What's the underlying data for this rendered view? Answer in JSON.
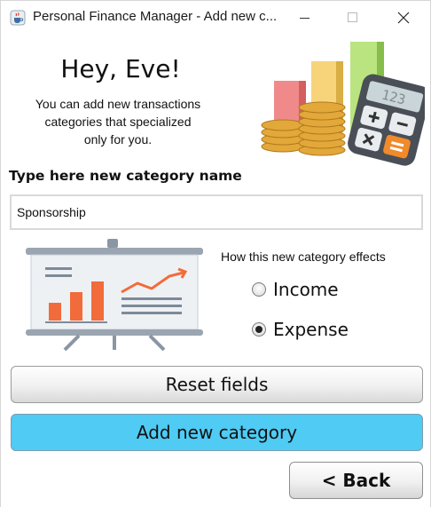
{
  "window": {
    "title": "Personal Finance Manager - Add new c...",
    "app_icon": "java-coffee-cup-icon",
    "controls": [
      "minimize-icon",
      "maximize-icon",
      "close-icon"
    ]
  },
  "header": {
    "greeting": "Hey, Eve!",
    "subtitle_lines": [
      "You can add new transactions",
      "categories that specialized",
      "only for you."
    ],
    "illustration": "finance-coins-calculator-icon"
  },
  "form": {
    "name_label": "Type here new category name",
    "name_value": "Sponsorship",
    "effects_label": "How this new category effects",
    "options": [
      {
        "label": "Income",
        "selected": false
      },
      {
        "label": "Expense",
        "selected": true
      }
    ],
    "illustration": "presentation-board-icon"
  },
  "buttons": {
    "reset": "Reset fields",
    "add": "Add new category",
    "back": "< Back"
  },
  "colors": {
    "add_button": "#4fcbf4",
    "board_bar": "#f26b3a"
  }
}
